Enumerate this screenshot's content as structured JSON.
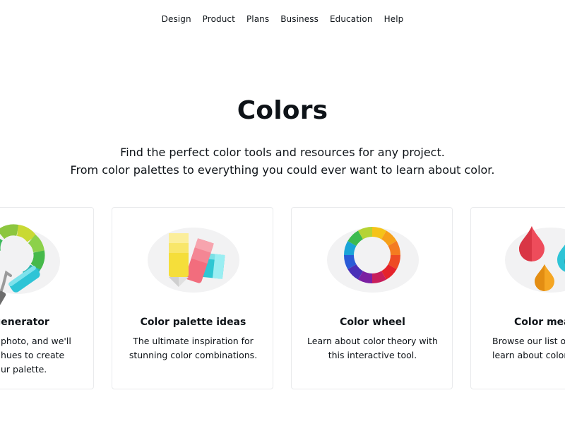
{
  "nav": {
    "items": [
      {
        "label": "Design"
      },
      {
        "label": "Product"
      },
      {
        "label": "Plans"
      },
      {
        "label": "Business"
      },
      {
        "label": "Education"
      },
      {
        "label": "Help"
      }
    ]
  },
  "hero": {
    "title": "Colors",
    "subtitle_line1": "Find the perfect color tools and resources for any project.",
    "subtitle_line2": "From color palettes to everything you could ever want to learn about color."
  },
  "cards": [
    {
      "title": "lette generator",
      "desc": [
        "photo, and we'll",
        "hues to create",
        "ur palette."
      ],
      "icon": "paint-roller-icon"
    },
    {
      "title": "Color palette ideas",
      "desc": [
        "The ultimate inspiration for",
        "stunning color combinations."
      ],
      "icon": "swatch-fan-icon"
    },
    {
      "title": "Color wheel",
      "desc": [
        "Learn about color theory with",
        "this interactive tool."
      ],
      "icon": "color-wheel-icon"
    },
    {
      "title": "Color mear",
      "desc": [
        "Browse our list of",
        "learn about color"
      ],
      "icon": "paint-drops-icon"
    }
  ]
}
